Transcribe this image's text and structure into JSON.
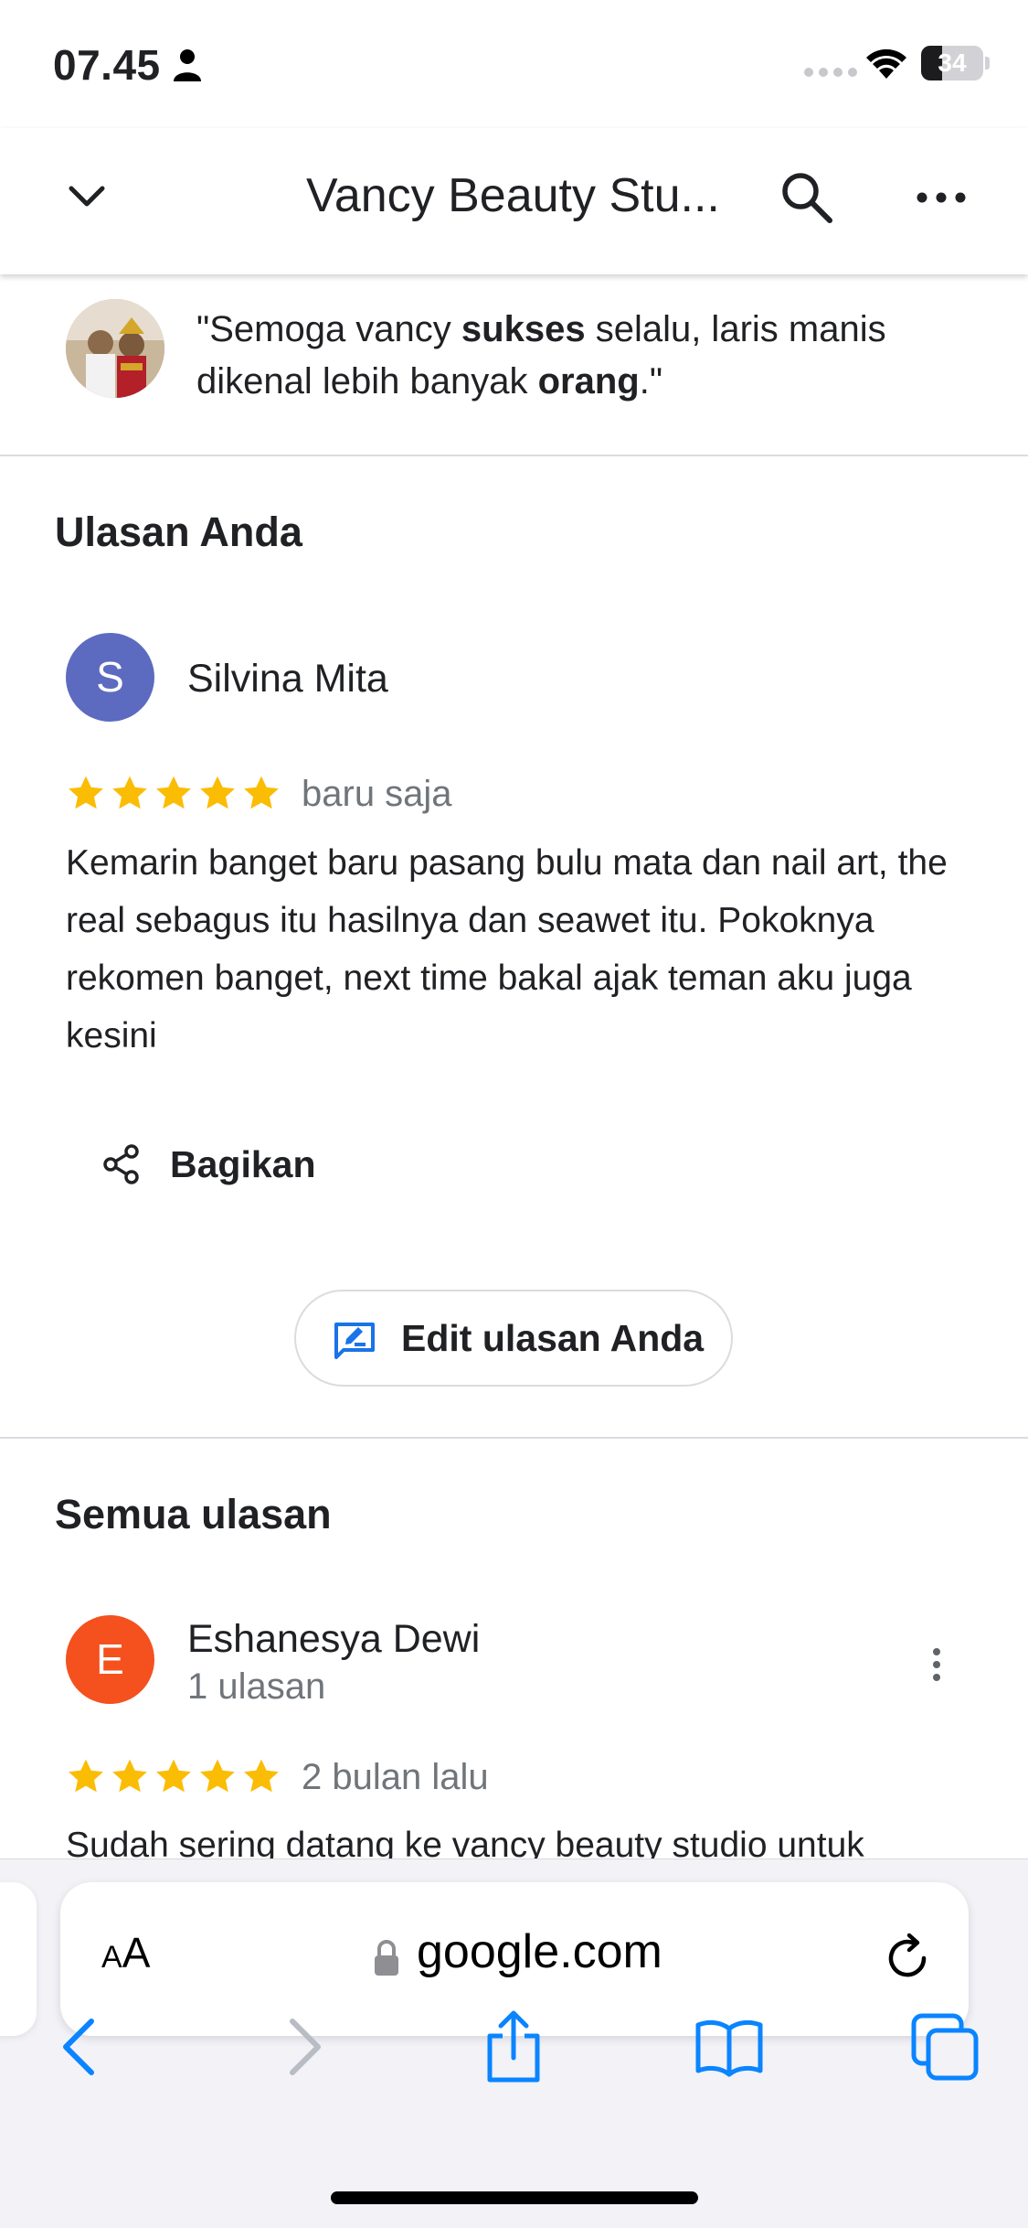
{
  "status_bar": {
    "time": "07.45",
    "battery_level": "34",
    "icons": [
      "person-icon",
      "signal-dots-icon",
      "wifi-icon",
      "battery-icon"
    ]
  },
  "header": {
    "title": "Vancy Beauty Stu...",
    "icons": [
      "chevron-down-icon",
      "search-icon",
      "more-horizontal-icon"
    ]
  },
  "highlight_quote": {
    "open": "\"Semoga vancy ",
    "bold1": "sukses",
    "middle": " selalu, laris manis dikenal lebih banyak ",
    "bold2": "orang",
    "close": ".\""
  },
  "your_review": {
    "section_title": "Ulasan Anda",
    "reviewer": {
      "initial": "S",
      "name": "Silvina Mita",
      "avatar_color": "#5c6bc0"
    },
    "rating": 5,
    "date": "baru saja",
    "text": "Kemarin banget baru pasang bulu mata dan nail art, the real sebagus itu hasilnya dan seawet itu. Pokoknya rekomen banget, next time bakal ajak teman aku juga kesini",
    "share_label": "Bagikan",
    "edit_label": "Edit ulasan Anda"
  },
  "all_reviews": {
    "section_title": "Semua ulasan",
    "items": [
      {
        "initial": "E",
        "name": "Eshanesya Dewi",
        "meta": "1 ulasan",
        "avatar_color": "#f4511e",
        "rating": 5,
        "date": "2 bulan lalu",
        "text": "Sudah sering datang ke vancy beauty studio untuk"
      }
    ]
  },
  "safari": {
    "aa_label_small": "A",
    "aa_label_large": "A",
    "url": "google.com",
    "icons": [
      "lock-icon",
      "reload-icon",
      "back-arrow-icon",
      "forward-arrow-icon",
      "share-icon",
      "bookmarks-icon",
      "tabs-icon"
    ]
  },
  "colors": {
    "star": "#fbbc04",
    "accent_blue": "#1a73e8",
    "safari_blue": "#0a84ff",
    "divider": "#dadce0",
    "secondary_text": "#70757a"
  }
}
